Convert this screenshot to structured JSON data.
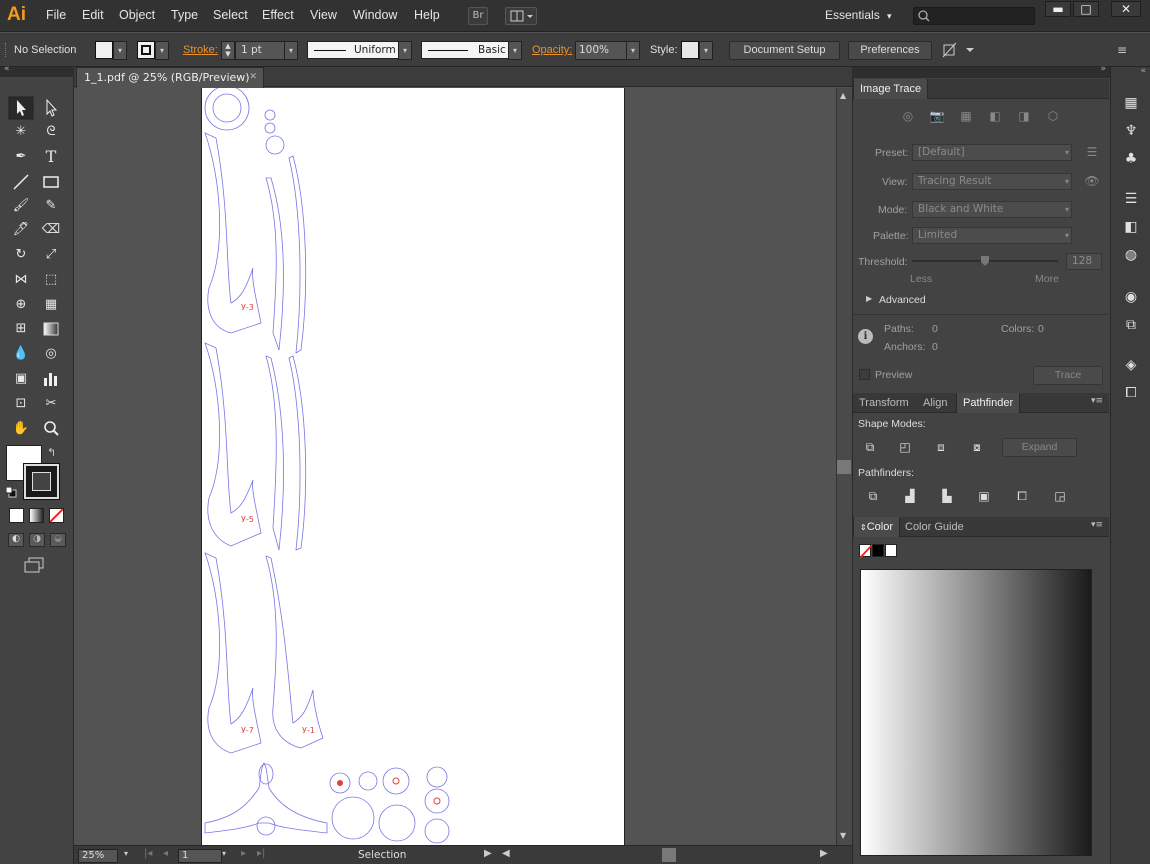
{
  "app": {
    "logo": "Ai"
  },
  "menu": [
    "File",
    "Edit",
    "Object",
    "Type",
    "Select",
    "Effect",
    "View",
    "Window",
    "Help"
  ],
  "menubar_right": {
    "bridge_label": "Br",
    "workspace": "Essentials",
    "workspace_arrow": "▾",
    "search_placeholder": ""
  },
  "window_controls": {
    "minimize": "▬",
    "maximize": "□",
    "close": "✕"
  },
  "control_bar": {
    "selection_label": "No Selection",
    "stroke_label": "Stroke:",
    "stroke_weight": "1 pt",
    "stroke_profile": "Uniform",
    "brush": "Basic",
    "opacity_label": "Opacity:",
    "opacity_value": "100%",
    "style_label": "Style:",
    "document_setup": "Document Setup",
    "preferences": "Preferences"
  },
  "document": {
    "tab_title": "1_1.pdf @ 25% (RGB/Preview)",
    "tab_close": "✕"
  },
  "status_bar": {
    "zoom": "25%",
    "artboard": "1",
    "tool": "Selection"
  },
  "image_trace": {
    "tab": "Image Trace",
    "preset_label": "Preset:",
    "preset_value": "[Default]",
    "view_label": "View:",
    "view_value": "Tracing Result",
    "mode_label": "Mode:",
    "mode_value": "Black and White",
    "palette_label": "Palette:",
    "palette_value": "Limited",
    "threshold_label": "Threshold:",
    "threshold_value": "128",
    "threshold_level": 0.5,
    "less": "Less",
    "more": "More",
    "advanced": "Advanced",
    "paths_label": "Paths:",
    "paths_value": "0",
    "colors_label": "Colors:",
    "colors_value": "0",
    "anchors_label": "Anchors:",
    "anchors_value": "0",
    "preview_label": "Preview",
    "trace_button": "Trace"
  },
  "pathfinder_panel": {
    "tabs": [
      "Transform",
      "Align",
      "Pathfinder"
    ],
    "active_tab": "Pathfinder",
    "shape_modes_label": "Shape Modes:",
    "expand_button": "Expand",
    "pathfinders_label": "Pathfinders:"
  },
  "color_panel": {
    "tabs": [
      "Color",
      "Color Guide"
    ],
    "active_tab": "Color"
  },
  "colors": {
    "accent_orange": "#f39b1a",
    "artwork_stroke": "#6a6ae0",
    "artwork_red": "#e04040"
  }
}
